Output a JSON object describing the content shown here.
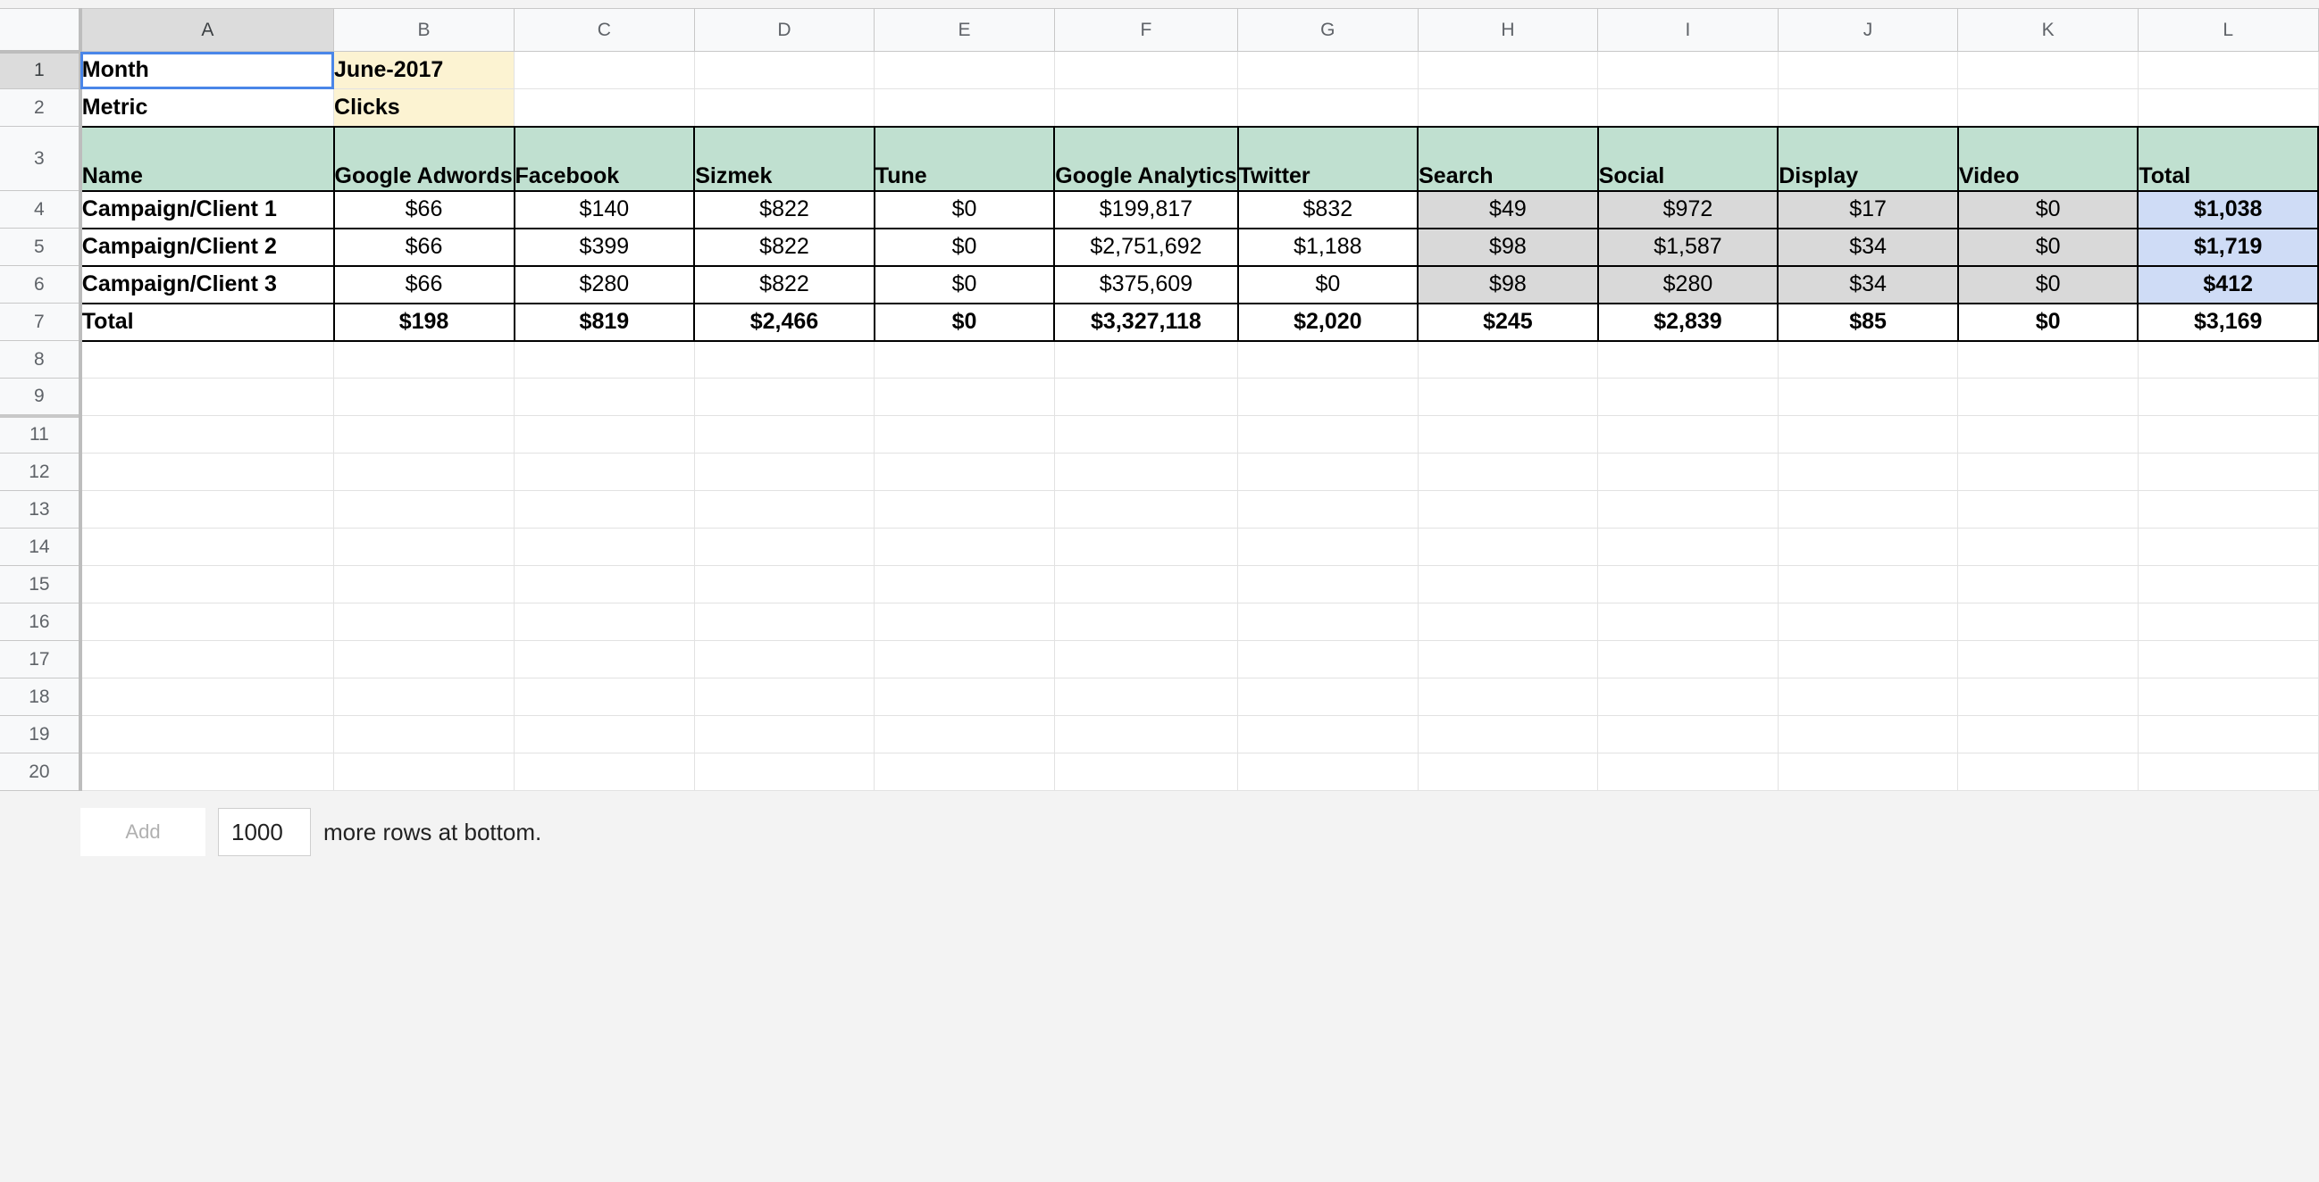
{
  "columns": [
    "A",
    "B",
    "C",
    "D",
    "E",
    "F",
    "G",
    "H",
    "I",
    "J",
    "K",
    "L"
  ],
  "row_numbers": [
    "1",
    "2",
    "3",
    "4",
    "5",
    "6",
    "7",
    "8",
    "9",
    "11",
    "12",
    "13",
    "14",
    "15",
    "16",
    "17",
    "18",
    "19",
    "20"
  ],
  "cells": {
    "a1": "Month",
    "b1": "June-2017",
    "a2": "Metric",
    "b2": "Clicks",
    "header": [
      "Name",
      "Google Adwords",
      "Facebook",
      "Sizmek",
      "Tune",
      "Google Analytics",
      "Twitter",
      "Search",
      "Social",
      "Display",
      "Video",
      "Total"
    ],
    "rows": [
      [
        "Campaign/Client 1",
        "$66",
        "$140",
        "$822",
        "$0",
        "$199,817",
        "$832",
        "$49",
        "$972",
        "$17",
        "$0",
        "$1,038"
      ],
      [
        "Campaign/Client 2",
        "$66",
        "$399",
        "$822",
        "$0",
        "$2,751,692",
        "$1,188",
        "$98",
        "$1,587",
        "$34",
        "$0",
        "$1,719"
      ],
      [
        "Campaign/Client 3",
        "$66",
        "$280",
        "$822",
        "$0",
        "$375,609",
        "$0",
        "$98",
        "$280",
        "$34",
        "$0",
        "$412"
      ],
      [
        "Total",
        "$198",
        "$819",
        "$2,466",
        "$0",
        "$3,327,118",
        "$2,020",
        "$245",
        "$2,839",
        "$85",
        "$0",
        "$3,169"
      ]
    ]
  },
  "footer": {
    "add_label": "Add",
    "rows_value": "1000",
    "suffix": "more rows at bottom."
  },
  "colors": {
    "header_fill": "#c0e0d0",
    "input_fill": "#fcf3d2",
    "gray_fill": "#d9d9d9",
    "total_fill": "#cfdcf6",
    "selection": "#4a86e8"
  }
}
